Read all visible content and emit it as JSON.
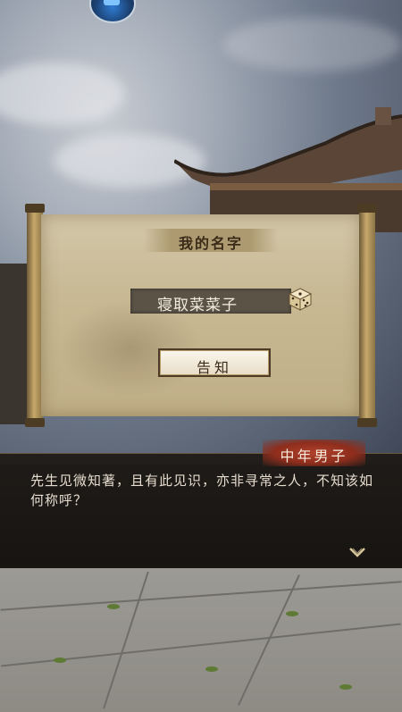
{
  "dialog": {
    "title": "我的名字",
    "name_value": "寝取菜菜子",
    "confirm_label": "告知"
  },
  "conversation": {
    "speaker": "中年男子",
    "text": "先生见微知著，且有此见识，亦非寻常之人，不知该如何称呼？"
  },
  "icons": {
    "dice": "dice-icon",
    "next": "chevron-down-icon",
    "top": "app-menu-icon"
  },
  "colors": {
    "paper": "#c8b994",
    "name_box": "#5b5346",
    "speaker_tag": "#a8392a",
    "dialog_bg": "#1e1a16",
    "arrow": "#d8c59a"
  }
}
